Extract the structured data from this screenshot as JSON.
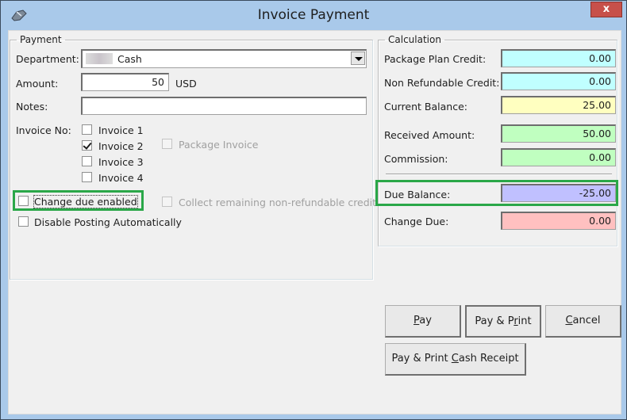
{
  "window": {
    "title": "Invoice Payment",
    "close_label": "x",
    "icon": "app-wand-icon"
  },
  "payment": {
    "legend": "Payment",
    "department_label": "Department:",
    "department_value": "Cash",
    "amount_label": "Amount:",
    "amount_value": "50",
    "currency": "USD",
    "notes_label": "Notes:",
    "notes_value": "",
    "invoice_no_label": "Invoice No:",
    "invoices": [
      {
        "label": "Invoice 1",
        "checked": false
      },
      {
        "label": "Invoice 2",
        "checked": true
      },
      {
        "label": "Invoice 3",
        "checked": false
      },
      {
        "label": "Invoice 4",
        "checked": false
      }
    ],
    "package_invoice_label": "Package Invoice",
    "change_due_enabled_label": "Change due enabled",
    "collect_remaining_label": "Collect remaining non-refundable credit",
    "disable_posting_label": "Disable Posting Automatically"
  },
  "calculation": {
    "legend": "Calculation",
    "package_plan_credit_label": "Package Plan Credit:",
    "package_plan_credit_value": "0.00",
    "non_refundable_credit_label": "Non Refundable Credit:",
    "non_refundable_credit_value": "0.00",
    "current_balance_label": "Current Balance:",
    "current_balance_value": "25.00",
    "received_amount_label": "Received Amount:",
    "received_amount_value": "50.00",
    "commission_label": "Commission:",
    "commission_value": "0.00",
    "due_balance_label": "Due Balance:",
    "due_balance_value": "-25.00",
    "change_due_label": "Change Due:",
    "change_due_value": "0.00"
  },
  "colors": {
    "credit_field": "#c0ffff",
    "balance_field": "#ffffc0",
    "received_field": "#c0ffc0",
    "due_field": "#c0c0ff",
    "change_field": "#ffc0c0",
    "highlight": "#2aa748"
  },
  "buttons": {
    "pay": {
      "pre": "",
      "mnemonic": "P",
      "post": "ay"
    },
    "pay_print": {
      "pre": "Pay & P",
      "mnemonic": "r",
      "post": "int"
    },
    "cancel": {
      "pre": "",
      "mnemonic": "C",
      "post": "ancel"
    },
    "pay_print_cash": {
      "pre": "Pay & Print ",
      "mnemonic": "C",
      "post": "ash Receipt"
    }
  }
}
